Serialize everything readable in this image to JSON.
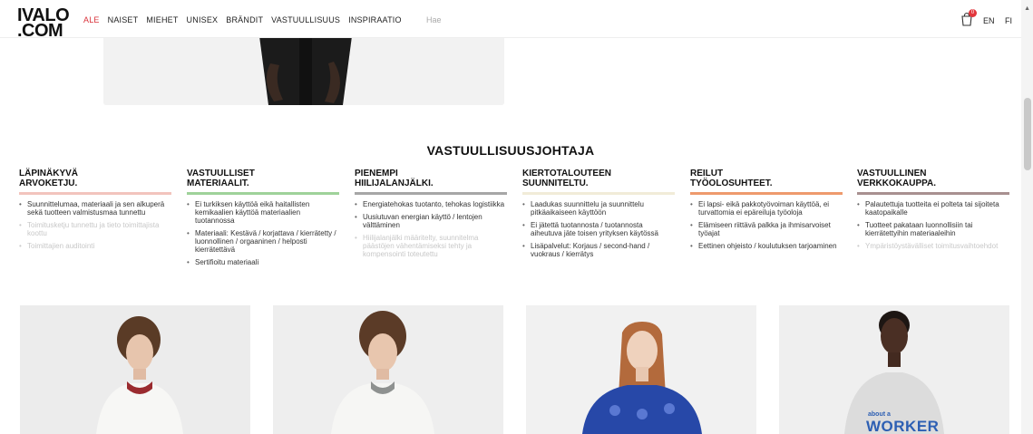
{
  "header": {
    "logo_line1": "IVALO",
    "logo_line2": ".COM",
    "nav": [
      "ALE",
      "NAISET",
      "MIEHET",
      "UNISEX",
      "BRÄNDIT",
      "VASTUULLISUUS",
      "INSPIRAATIO"
    ],
    "search_placeholder": "Hae",
    "cart_count": "0",
    "lang_en": "EN",
    "lang_fi": "FI"
  },
  "section": {
    "title": "VASTUULLISUUSJOHTAJA"
  },
  "columns": [
    {
      "head": [
        "LÄPINÄKYVÄ",
        "ARVOKETJU."
      ],
      "bar_color": "#f2c4bd",
      "items": [
        {
          "text": "Suunnittelumaa, materiaali ja sen alkuperä sekä tuotteen valmistusmaa tunnettu",
          "active": true
        },
        {
          "text": "Toimitusketju tunnettu ja tieto toimittajista koottu",
          "active": false
        },
        {
          "text": "Toimittajien auditointi",
          "active": false
        }
      ]
    },
    {
      "head": [
        "VASTUULLISET",
        "MATERIAALIT."
      ],
      "bar_color": "#9fd29a",
      "items": [
        {
          "text": "Ei turkiksen käyttöä eikä haitallisten kemikaalien käyttöä materiaalien tuotannossa",
          "active": true
        },
        {
          "text": "Materiaali: Kestävä / korjattava / kierrätetty / luonnollinen / orgaaninen / helposti kierrätettävä",
          "active": true
        },
        {
          "text": "Sertifioitu materiaali",
          "active": true
        }
      ]
    },
    {
      "head": [
        "PIENEMPI",
        "HIILIJALANJÄLKI."
      ],
      "bar_color": "#a6a6a6",
      "items": [
        {
          "text": "Energiatehokas tuotanto, tehokas logistiikka",
          "active": true
        },
        {
          "text": "Uusiutuvan energian käyttö / lentojen välttäminen",
          "active": true
        },
        {
          "text": "Hiilijalanjälki määritelty, suunnitelma päästöjen vähentämiseksi tehty ja kompensointi toteutettu",
          "active": false
        }
      ]
    },
    {
      "head": [
        "KIERTOTALOUTEEN",
        "SUUNNITELTU."
      ],
      "bar_color": "#f1ecd8",
      "items": [
        {
          "text": "Laadukas suunnittelu ja suunnittelu pitkäaikaiseen käyttöön",
          "active": true
        },
        {
          "text": "Ei jätettä tuotannosta / tuotannosta aiheutuva jäte toisen yrityksen käytössä",
          "active": true
        },
        {
          "text": "Lisäpalvelut: Korjaus / second-hand / vuokraus / kierrätys",
          "active": true
        }
      ]
    },
    {
      "head": [
        "REILUT",
        "TYÖOLOSUHTEET."
      ],
      "bar_color": "#ee9a6d",
      "items": [
        {
          "text": "Ei lapsi- eikä pakkotyövoiman käyttöä, ei turvattomia ei epäreiluja työoloja",
          "active": true
        },
        {
          "text": "Elämiseen riittävä palkka ja ihmisarvoiset työajat",
          "active": true
        },
        {
          "text": "Eettinen ohjeisto / koulutuksen tarjoaminen",
          "active": true
        }
      ]
    },
    {
      "head": [
        "VASTUULLINEN",
        "VERKKOKAUPPA."
      ],
      "bar_color": "#a89090",
      "items": [
        {
          "text": "Palautettuja tuotteita ei polteta tai sijoiteta kaatopaikalle",
          "active": true
        },
        {
          "text": "Tuotteet pakataan luonnollisiin tai kierrätettyihin materiaaleihin",
          "active": true
        },
        {
          "text": "Ympäristöystävälliset toimitusvaihtoehdot",
          "active": false
        }
      ]
    }
  ],
  "products": [
    {
      "image": "model-curly-hair-white-shirt-red-collar"
    },
    {
      "image": "model-curly-hair-white-shirt-grey-collar"
    },
    {
      "image": "model-long-hair-blue-patterned-sweater"
    },
    {
      "image": "model-grey-sweatshirt",
      "print_line1": "about a",
      "print_line2": "WORKER"
    }
  ],
  "colors": {
    "sale": "#d9323a",
    "badge": "#e2363c"
  }
}
